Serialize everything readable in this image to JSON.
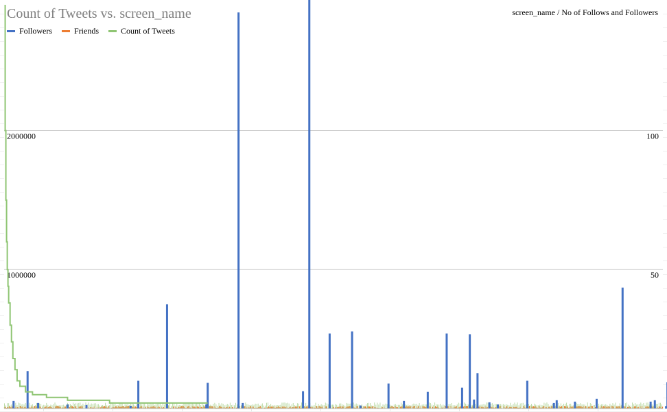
{
  "chart_data": {
    "type": "bar",
    "title": "Count of Tweets vs. screen_name",
    "secondary_axis_title": "screen_name / No of Follows and Followers",
    "ylim": [
      0,
      2900000
    ],
    "y2lim": [
      0,
      145
    ],
    "y_ticks": [
      {
        "value": 1000000,
        "label": "1000000"
      },
      {
        "value": 2000000,
        "label": "2000000"
      }
    ],
    "y2_ticks": [
      {
        "value": 50,
        "label": "50"
      },
      {
        "value": 100,
        "label": "100"
      }
    ],
    "n_categories": 940,
    "grid": true,
    "legend_position": "top-left",
    "series": [
      {
        "name": "Followers",
        "type": "bar",
        "color": "#4472c4",
        "axis": "primary",
        "points": [
          [
            13,
            55000
          ],
          [
            33,
            270000
          ],
          [
            48,
            40000
          ],
          [
            90,
            30000
          ],
          [
            117,
            25000
          ],
          [
            180,
            20000
          ],
          [
            191,
            200000
          ],
          [
            232,
            750000
          ],
          [
            288,
            30000
          ],
          [
            290,
            185000
          ],
          [
            334,
            2850000
          ],
          [
            340,
            40000
          ],
          [
            426,
            125000
          ],
          [
            435,
            2950000
          ],
          [
            464,
            540000
          ],
          [
            496,
            555000
          ],
          [
            508,
            22000
          ],
          [
            548,
            180000
          ],
          [
            570,
            55000
          ],
          [
            604,
            120000
          ],
          [
            631,
            540000
          ],
          [
            653,
            150000
          ],
          [
            664,
            535000
          ],
          [
            670,
            65000
          ],
          [
            675,
            255000
          ],
          [
            692,
            45000
          ],
          [
            704,
            30000
          ],
          [
            746,
            200000
          ],
          [
            784,
            40000
          ],
          [
            788,
            60000
          ],
          [
            814,
            50000
          ],
          [
            845,
            70000
          ],
          [
            882,
            870000
          ],
          [
            922,
            50000
          ],
          [
            928,
            60000
          ],
          [
            944,
            18000
          ],
          [
            946,
            190000
          ],
          [
            948,
            25000
          ],
          [
            950,
            75000
          ]
        ]
      },
      {
        "name": "Friends",
        "type": "bar",
        "color": "#ed7d31",
        "axis": "primary",
        "noise_level": 20000
      },
      {
        "name": "Count of Tweets",
        "type": "line",
        "color": "#8fc573",
        "axis": "secondary",
        "points": [
          [
            0,
            145
          ],
          [
            1,
            100
          ],
          [
            2,
            75
          ],
          [
            3,
            60
          ],
          [
            4,
            50
          ],
          [
            5,
            44
          ],
          [
            6,
            38
          ],
          [
            8,
            30
          ],
          [
            10,
            24
          ],
          [
            12,
            18
          ],
          [
            15,
            14
          ],
          [
            18,
            10
          ],
          [
            22,
            8
          ],
          [
            30,
            6
          ],
          [
            40,
            5
          ],
          [
            60,
            4
          ],
          [
            90,
            3
          ],
          [
            150,
            2
          ],
          [
            230,
            2
          ],
          [
            290,
            2
          ]
        ]
      }
    ]
  }
}
